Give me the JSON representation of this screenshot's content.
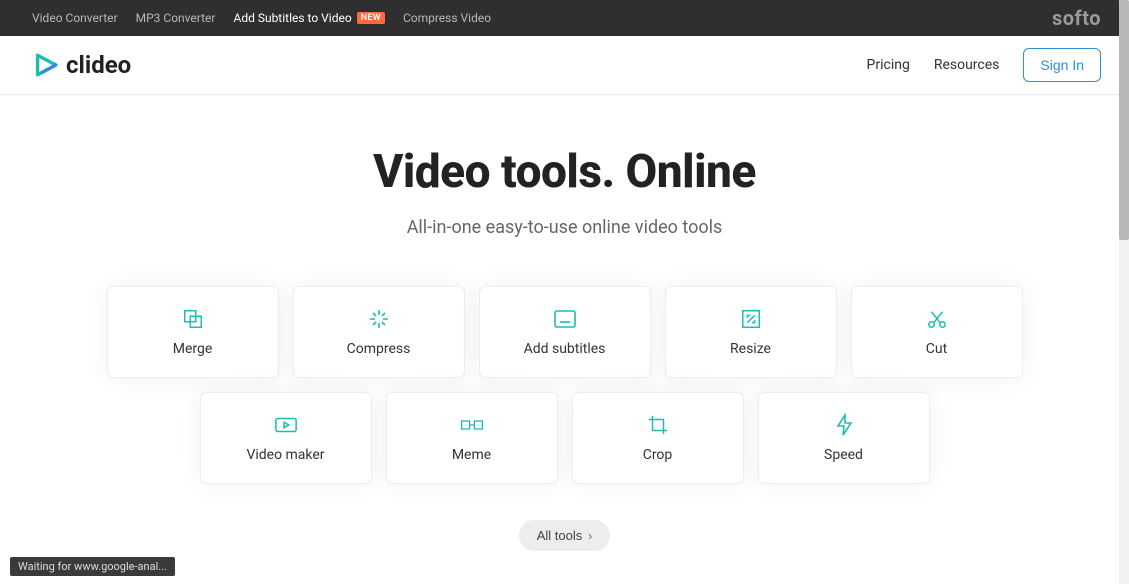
{
  "topbar": {
    "links": [
      {
        "label": "Video Converter",
        "active": false
      },
      {
        "label": "MP3 Converter",
        "active": false
      },
      {
        "label": "Add Subtitles to Video",
        "active": true,
        "badge": "NEW"
      },
      {
        "label": "Compress Video",
        "active": false
      }
    ],
    "right_brand": "softo"
  },
  "header": {
    "brand": "clideo",
    "pricing": "Pricing",
    "resources": "Resources",
    "signin": "Sign In"
  },
  "hero": {
    "title": "Video tools. Online",
    "subtitle": "All-in-one easy-to-use online video tools"
  },
  "tools_row1": [
    {
      "id": "merge",
      "label": "Merge"
    },
    {
      "id": "compress",
      "label": "Compress"
    },
    {
      "id": "add-subtitles",
      "label": "Add subtitles"
    },
    {
      "id": "resize",
      "label": "Resize"
    },
    {
      "id": "cut",
      "label": "Cut"
    }
  ],
  "tools_row2": [
    {
      "id": "video-maker",
      "label": "Video maker"
    },
    {
      "id": "meme",
      "label": "Meme"
    },
    {
      "id": "crop",
      "label": "Crop"
    },
    {
      "id": "speed",
      "label": "Speed"
    }
  ],
  "all_tools_label": "All tools",
  "status": "Waiting for www.google-anal...",
  "colors": {
    "accent": "#1abdb0",
    "link_blue": "#2b90d9",
    "badge": "#ff6a3d"
  }
}
